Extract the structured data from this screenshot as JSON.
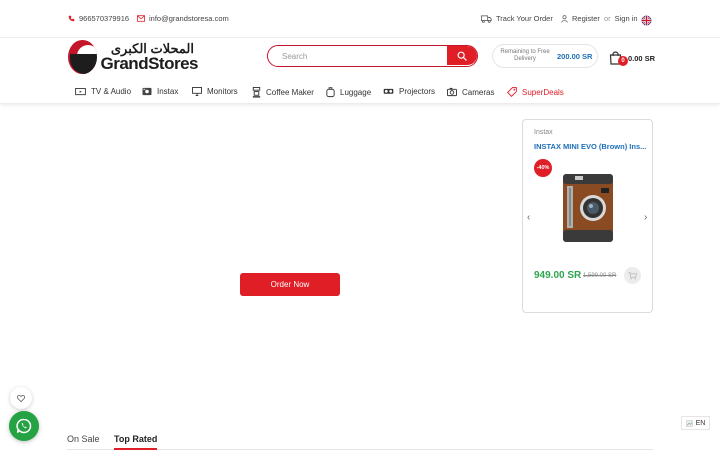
{
  "topbar": {
    "phone": "966570379916",
    "email": "info@grandstoresa.com",
    "track_order": "Track Your Order",
    "register": "Register",
    "or": "or",
    "sign_in": "Sign in"
  },
  "header": {
    "logo_arabic": "المحلات الكبرى",
    "logo_english": "GrandStores",
    "search_placeholder": "Search",
    "delivery_label": "Remaining to Free Delivery",
    "delivery_amount": "200.00 SR",
    "cart_count": "0",
    "cart_total": "0.00 SR"
  },
  "nav": {
    "items": [
      {
        "label": "TV & Audio",
        "icon": "tv-icon"
      },
      {
        "label": "Instax",
        "icon": "instax-camera-icon"
      },
      {
        "label": "Monitors",
        "icon": "monitor-icon"
      },
      {
        "label": "Coffee Maker",
        "icon": "coffee-maker-icon"
      },
      {
        "label": "Luggage",
        "icon": "luggage-icon"
      },
      {
        "label": "Projectors",
        "icon": "projector-icon"
      },
      {
        "label": "Cameras",
        "icon": "camera-icon"
      },
      {
        "label": "SuperDeals",
        "icon": "tag-icon"
      }
    ]
  },
  "hero": {
    "cta_label": "Order Now"
  },
  "product_card": {
    "brand": "Instax",
    "name": "INSTAX MINI EVO (Brown) Ins...",
    "discount": "-40%",
    "price": "949.00 SR",
    "old_price": "1,599.00 SR"
  },
  "tabs": [
    {
      "label": "On Sale",
      "active": false
    },
    {
      "label": "Top Rated",
      "active": true
    }
  ],
  "language": {
    "code": "EN"
  },
  "colors": {
    "brand_red": "#e01e26",
    "link_blue": "#1e6fb8",
    "price_green": "#2ea44f",
    "whatsapp_green": "#25a244"
  }
}
